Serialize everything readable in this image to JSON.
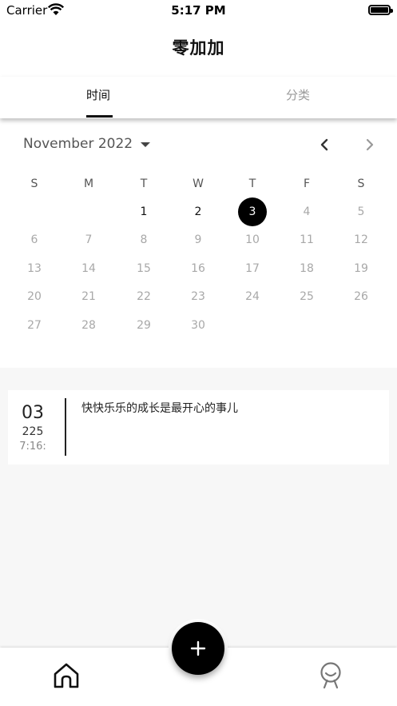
{
  "status_bar": {
    "carrier": "Carrier",
    "time": "5:17 PM"
  },
  "header": {
    "title": "零加加"
  },
  "tabs": [
    {
      "label": "时间",
      "active": true
    },
    {
      "label": "分类",
      "active": false
    }
  ],
  "calendar": {
    "month_label": "November 2022",
    "weekdays": [
      "S",
      "M",
      "T",
      "W",
      "T",
      "F",
      "S"
    ],
    "weeks": [
      [
        "",
        "",
        "1",
        "2",
        "3",
        "4",
        "5"
      ],
      [
        "6",
        "7",
        "8",
        "9",
        "10",
        "11",
        "12"
      ],
      [
        "13",
        "14",
        "15",
        "16",
        "17",
        "18",
        "19"
      ],
      [
        "20",
        "21",
        "22",
        "23",
        "24",
        "25",
        "26"
      ],
      [
        "27",
        "28",
        "29",
        "30",
        "",
        "",
        ""
      ]
    ],
    "selected_day": "3",
    "active_days": [
      "1",
      "2"
    ]
  },
  "entries": [
    {
      "day": "03",
      "year": "225",
      "time": "7:16:",
      "text": "快快乐乐的成长是最开心的事儿"
    }
  ],
  "icons": {
    "prev": "chevron-left-icon",
    "next": "chevron-right-icon",
    "add": "plus-icon",
    "home": "home-icon",
    "profile": "profile-icon"
  },
  "colors": {
    "accent": "#000000",
    "muted": "#a8a8a8",
    "list_bg": "#f7f7f7"
  }
}
